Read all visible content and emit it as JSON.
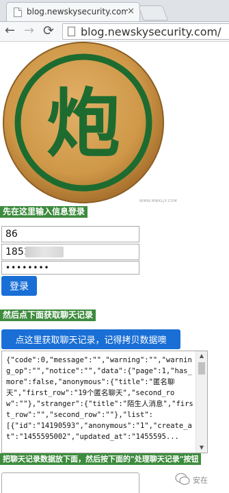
{
  "browser": {
    "tab_title": "blog.newskysecurity.com",
    "tab_close": "×",
    "url": "blog.newskysecurity.com/",
    "back": "←",
    "forward": "→",
    "reload": "⟳"
  },
  "logo": {
    "character": "炮",
    "tagline": "WWW.MWKLJY.COM",
    "colors": {
      "wood": "#d19a4c",
      "green": "#1e6b30"
    }
  },
  "login": {
    "label": "先在这里输入信息登录",
    "username": "86",
    "phone": "1851",
    "password": "••••••••",
    "button": "登录"
  },
  "fetch": {
    "label": "然后点下面获取聊天记录",
    "button": "点这里获取聊天记录，记得拷贝数据噢",
    "result": "{\"code\":0,\"message\":\"\",\"warning\":\"\",\"warning_op\":\"\",\"notice\":\"\",\"data\":{\"page\":1,\"has_more\":false,\"anonymous\":{\"title\":\"匿名聊天\",\"first_row\":\"19个匿名聊天\",\"second_row\":\"\"},\"stranger\":{\"title\":\"陌生人消息\",\"first_row\":\"\",\"second_row\":\"\"},\"list\":\n[{\"id\":\"14190593\",\"anonymous\":\"1\",\"create_at\":\"1455595002\",\"updated_at\":\"1455595..."
  },
  "process": {
    "label": "把聊天记录数据放下面，然后按下面的\"处理聊天记录\"按钮"
  },
  "watermark": {
    "text": "安在"
  },
  "colors": {
    "label_green": "#3d8b3d",
    "button_blue": "#1a6fd6"
  }
}
